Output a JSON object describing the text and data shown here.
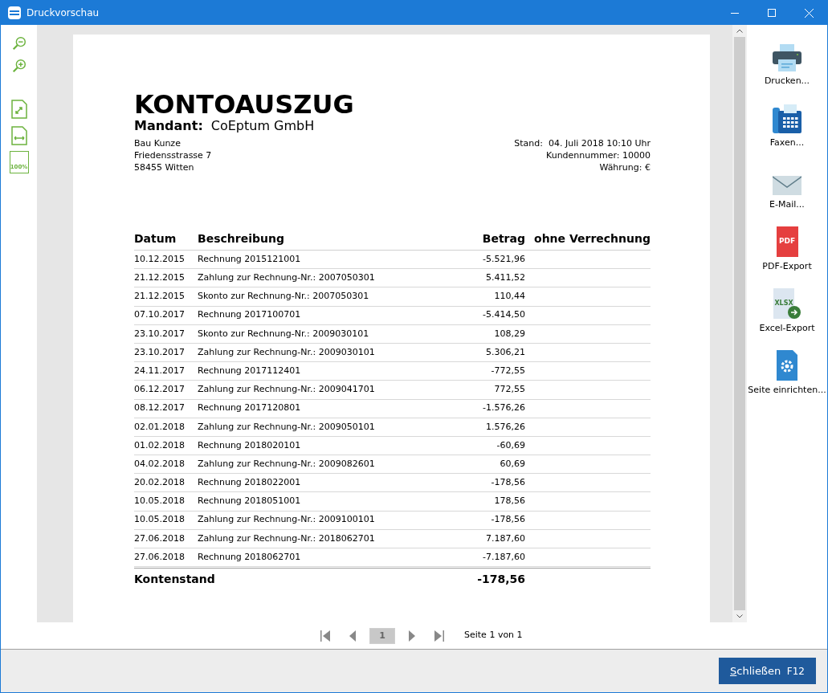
{
  "window": {
    "title": "Druckvorschau"
  },
  "toolbar": [
    {
      "kind": "zoom-out"
    },
    {
      "kind": "zoom-in"
    },
    {
      "kind": "fit-page"
    },
    {
      "kind": "fit-width"
    },
    {
      "kind": "actual-size",
      "label": "100%"
    }
  ],
  "document": {
    "title": "KONTOAUSZUG",
    "client_label": "Mandant:",
    "client": "CoEptum GmbH",
    "address": [
      "Bau Kunze",
      "Friedensstrasse 7",
      "58455 Witten"
    ],
    "info": [
      "Stand:  04. Juli 2018 10:10 Uhr",
      "Kundennummer: 10000",
      "Währung: €"
    ],
    "table": {
      "columns": [
        "Datum",
        "Beschreibung",
        "Betrag",
        "ohne Verrechnung"
      ],
      "rows": [
        [
          "10.12.2015",
          "Rechnung 2015121001",
          "-5.521,96"
        ],
        [
          "21.12.2015",
          "Zahlung zur Rechnung-Nr.: 2007050301",
          "5.411,52"
        ],
        [
          "21.12.2015",
          "Skonto zur Rechnung-Nr.: 2007050301",
          "110,44"
        ],
        [
          "07.10.2017",
          "Rechnung 2017100701",
          "-5.414,50"
        ],
        [
          "23.10.2017",
          "Skonto zur Rechnung-Nr.: 2009030101",
          "108,29"
        ],
        [
          "23.10.2017",
          "Zahlung zur Rechnung-Nr.: 2009030101",
          "5.306,21"
        ],
        [
          "24.11.2017",
          "Rechnung 2017112401",
          "-772,55"
        ],
        [
          "06.12.2017",
          "Zahlung zur Rechnung-Nr.: 2009041701",
          "772,55"
        ],
        [
          "08.12.2017",
          "Rechnung 2017120801",
          "-1.576,26"
        ],
        [
          "02.01.2018",
          "Zahlung zur Rechnung-Nr.: 2009050101",
          "1.576,26"
        ],
        [
          "01.02.2018",
          "Rechnung 2018020101",
          "-60,69"
        ],
        [
          "04.02.2018",
          "Zahlung zur Rechnung-Nr.: 2009082601",
          "60,69"
        ],
        [
          "20.02.2018",
          "Rechnung 2018022001",
          "-178,56"
        ],
        [
          "10.05.2018",
          "Rechnung 2018051001",
          "178,56"
        ],
        [
          "10.05.2018",
          "Zahlung zur Rechnung-Nr.: 2009100101",
          "-178,56"
        ],
        [
          "27.06.2018",
          "Zahlung zur Rechnung-Nr.: 2018062701",
          "7.187,60"
        ],
        [
          "27.06.2018",
          "Rechnung 2018062701",
          "-7.187,60"
        ]
      ],
      "total_label": "Kontenstand",
      "total": "-178,56"
    }
  },
  "pager": {
    "page": "1",
    "status": "Seite 1 von 1"
  },
  "actions": [
    {
      "kind": "print",
      "label": "Drucken..."
    },
    {
      "kind": "fax",
      "label": "Faxen..."
    },
    {
      "kind": "mail",
      "label": "E-Mail..."
    },
    {
      "kind": "pdf",
      "label": "PDF-Export",
      "badge": "PDF"
    },
    {
      "kind": "excel",
      "label": "Excel-Export",
      "badge": "XLSX"
    },
    {
      "kind": "setup",
      "label": "Seite einrichten..."
    }
  ],
  "footer": {
    "close": {
      "label": "Schließen",
      "key": "F12"
    }
  }
}
